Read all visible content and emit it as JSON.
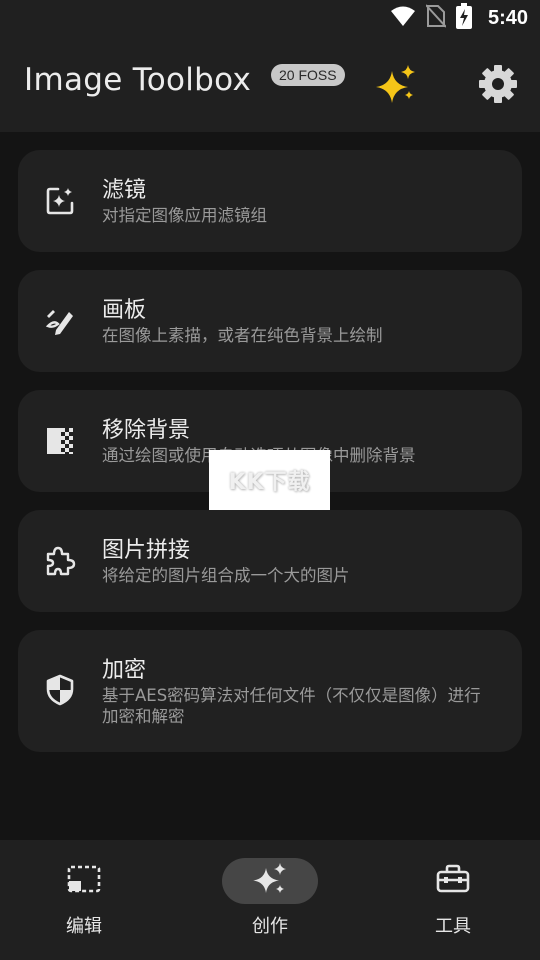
{
  "status_bar": {
    "time": "5:40",
    "icons": [
      "wifi-icon",
      "no-sim-icon",
      "battery-charging-icon"
    ]
  },
  "app_bar": {
    "title": "Image Toolbox",
    "badge": "20 FOSS",
    "actions": [
      "sparkles-icon",
      "gear-icon"
    ]
  },
  "tools": [
    {
      "icon": "filter-icon",
      "title": "滤镜",
      "description": "对指定图像应用滤镜组"
    },
    {
      "icon": "draw-icon",
      "title": "画板",
      "description": "在图像上素描，或者在纯色背景上绘制"
    },
    {
      "icon": "remove-background-icon",
      "title": "移除背景",
      "description": "通过绘图或使用自动选项从图像中删除背景"
    },
    {
      "icon": "puzzle-icon",
      "title": "图片拼接",
      "description": "将给定的图片组合成一个大的图片"
    },
    {
      "icon": "shield-icon",
      "title": "加密",
      "description": "基于AES密码算法对任何文件（不仅仅是图像）进行加密和解密"
    }
  ],
  "watermark": {
    "text": "KK下载"
  },
  "bottom_nav": {
    "items": [
      {
        "label": "编辑",
        "icon": "edit-frame-icon",
        "active": false
      },
      {
        "label": "创作",
        "icon": "sparkles-icon",
        "active": true
      },
      {
        "label": "工具",
        "icon": "toolbox-icon",
        "active": false
      }
    ]
  },
  "colors": {
    "background": "#141414",
    "bar": "#202020",
    "card": "#212121",
    "active_pill": "#464646",
    "badge": "#c8c8c8",
    "sparkle_accent": "#f5c518"
  }
}
